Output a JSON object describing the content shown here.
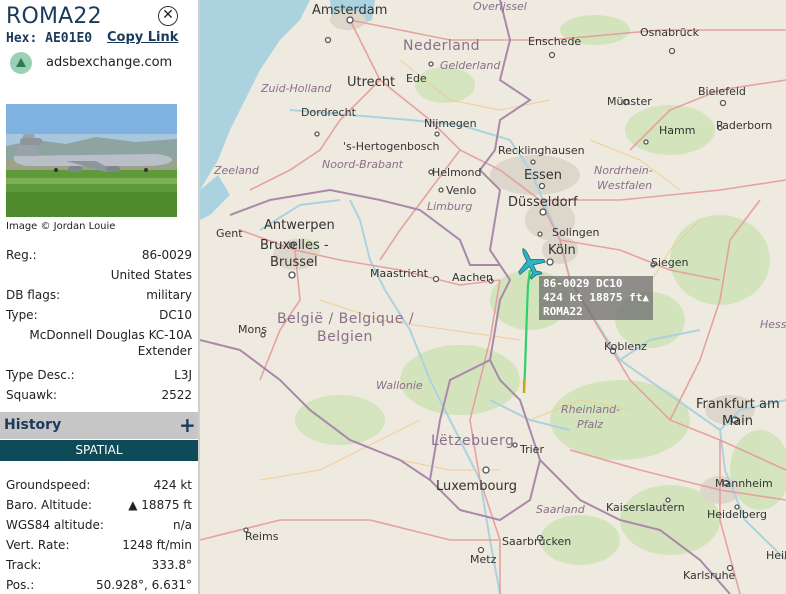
{
  "sidebar": {
    "title": "ROMA22",
    "hex_label": "Hex:",
    "hex_value": "AE01E0",
    "copy_link": "Copy Link",
    "adsb_link": "adsbexchange.com",
    "image_credit": "Image © Jordan Louie",
    "fields": {
      "reg_label": "Reg.:",
      "reg_value": "86-0029",
      "country": "United States",
      "db_flags_label": "DB flags:",
      "db_flags_value": "military",
      "type_label": "Type:",
      "type_value": "DC10",
      "type_name_1": "McDonnell Douglas KC-10A",
      "type_name_2": "Extender",
      "type_desc_label": "Type Desc.:",
      "type_desc_value": "L3J",
      "squawk_label": "Squawk:",
      "squawk_value": "2522"
    },
    "history_label": "History",
    "history_plus": "+",
    "spatial_label": "SPATIAL",
    "spatial": {
      "groundspeed_label": "Groundspeed:",
      "groundspeed_value": "424 kt",
      "baro_label": "Baro. Altitude:",
      "baro_value": "▲ 18875 ft",
      "wgs_label": "WGS84 altitude:",
      "wgs_value": "n/a",
      "vrate_label": "Vert. Rate:",
      "vrate_value": "1248 ft/min",
      "track_label": "Track:",
      "track_value": "333.8°",
      "pos_label": "Pos.:",
      "pos_value": "50.928°, 6.631°"
    }
  },
  "map": {
    "aircraft_label": {
      "line1": "86-0029 DC10",
      "line2": "424 kt  18875 ft▲",
      "line3": "ROMA22"
    },
    "labels": {
      "amsterdam": "Amsterdam",
      "overijssel": "Overijssel",
      "nederland": "Nederland",
      "enschede": "Enschede",
      "osnabruck": "Osnabrück",
      "gelderland": "Gelderland",
      "zuid_holland": "Zuid-Holland",
      "utrecht": "Utrecht",
      "ede": "Ede",
      "bielefeld": "Bielefeld",
      "munster": "Münster",
      "dordrecht": "Dordrecht",
      "nijmegen": "Nijmegen",
      "hamm": "Hamm",
      "paderborn": "Paderborn",
      "s_hertogenbosch": "'s-Hertogenbosch",
      "recklinghausen": "Recklinghausen",
      "zeeland": "Zeeland",
      "noord_brabant": "Noord-Brabant",
      "helmond": "Helmond",
      "essen": "Essen",
      "nordrhein": "Nordrhein-",
      "westfalen": "Westfalen",
      "venlo": "Venlo",
      "limburg": "Limburg",
      "dusseldorf": "Düsseldorf",
      "gent": "Gent",
      "antwerpen": "Antwerpen",
      "solingen": "Solingen",
      "bruxelles1": "Bruxelles -",
      "bruxelles2": "Brussel",
      "koln": "Köln",
      "maastricht": "Maastricht",
      "aachen": "Aachen",
      "siegen": "Siegen",
      "belgie1": "België / Belgique /",
      "belgie2": "Belgien",
      "mons": "Mons",
      "hesse": "Hesse",
      "koblenz": "Koblenz",
      "wallonie": "Wallonie",
      "frankfurt1": "Frankfurt am",
      "frankfurt2": "Main",
      "rheinland": "Rheinland-",
      "pfalz": "Pfalz",
      "letzebuerg": "Lëtzebuerg",
      "trier": "Trier",
      "luxembourg": "Luxembourg",
      "mannheim": "Mannheim",
      "saarland": "Saarland",
      "kaiserslautern": "Kaiserslautern",
      "heidelberg": "Heidelberg",
      "reims": "Reims",
      "saarbrucken": "Saarbrücken",
      "metz": "Metz",
      "karlsruhe": "Karlsruhe",
      "heil": "Heil"
    },
    "colors": {
      "land": "#efeadf",
      "water": "#aad3df",
      "border": "#a988a9",
      "road": "#e69a9a",
      "trail": "#2fd06a",
      "aircraft": "#2fb3c2"
    }
  }
}
